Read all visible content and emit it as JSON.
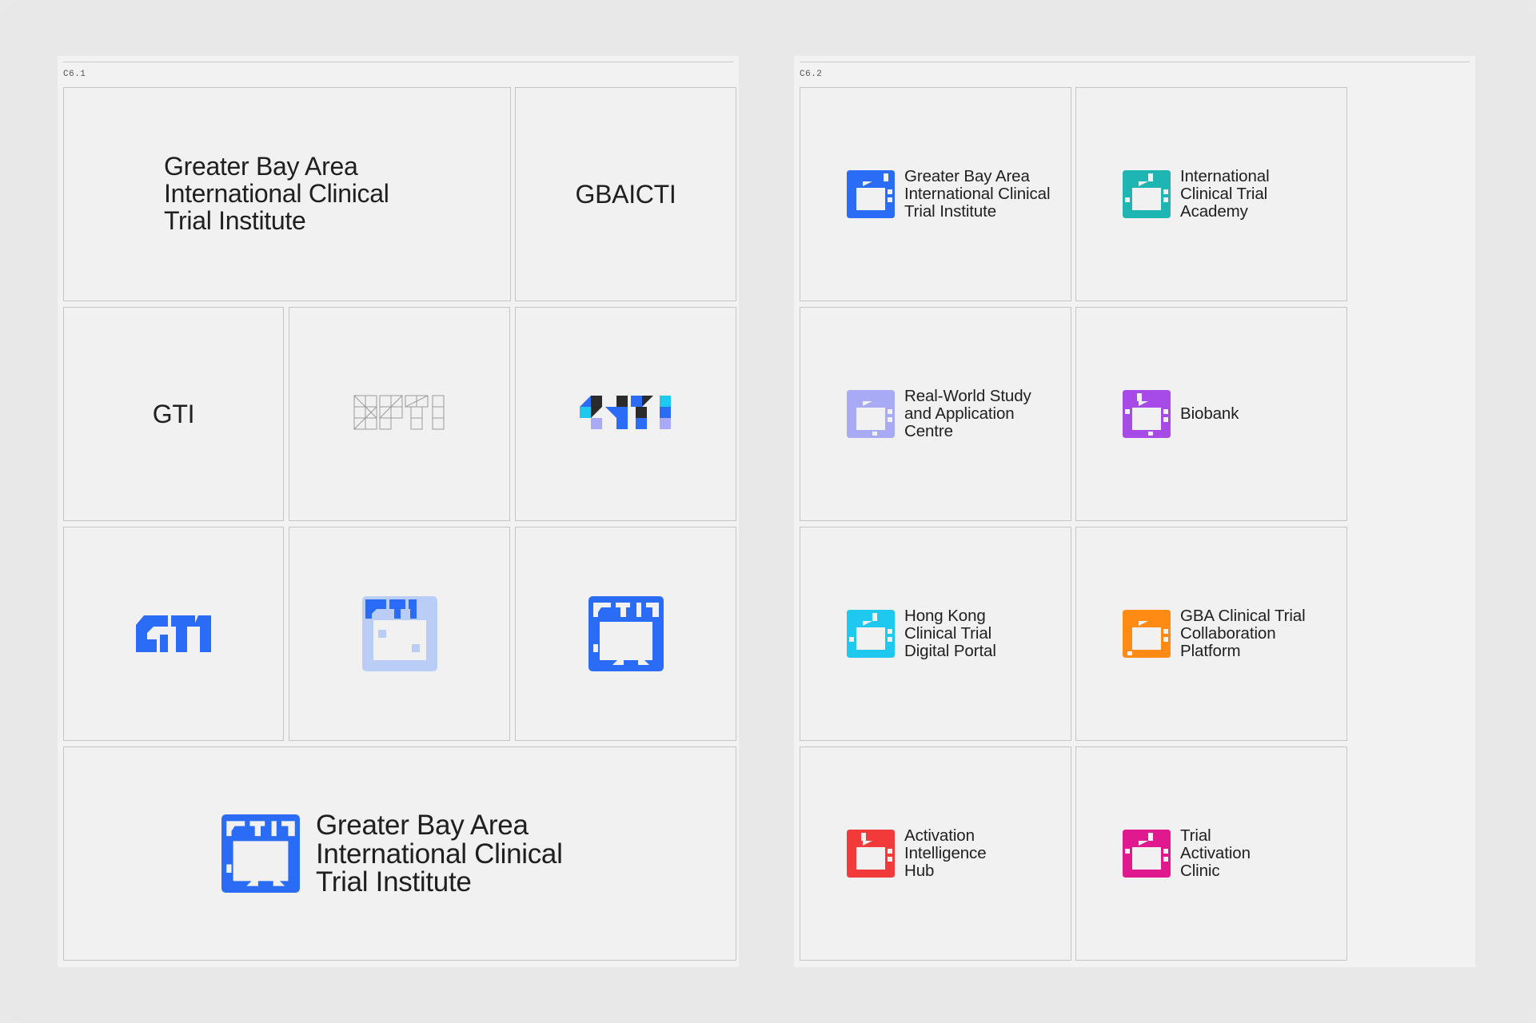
{
  "sheets": {
    "left": {
      "code": "C6.1"
    },
    "right": {
      "code": "C6.2"
    }
  },
  "left": {
    "full_name": [
      "Greater Bay Area",
      "International Clinical",
      "Trial Institute"
    ],
    "acronym": "GBAICTI",
    "short": "GTI",
    "lockup_name": [
      "Greater Bay Area",
      "International Clinical",
      "Trial Institute"
    ]
  },
  "colors": {
    "primary_blue": "#2a6cf5",
    "light_blue": "#b9cdf6",
    "teal": "#1fb5b3",
    "lavender": "#a8aaf5",
    "purple": "#a64be8",
    "cyan": "#1ec8ee",
    "orange": "#ff8a14",
    "red": "#f33a3a",
    "magenta": "#e0198f",
    "dark": "#2b2b2b"
  },
  "sub_brands": [
    {
      "lines": [
        "Greater Bay Area",
        "International Clinical",
        "Trial Institute"
      ],
      "color": "#2a6cf5",
      "icon": "gbaicti-mark-icon"
    },
    {
      "lines": [
        "International",
        "Clinical Trial",
        "Academy"
      ],
      "color": "#1fb5b3",
      "icon": "academy-mark-icon"
    },
    {
      "lines": [
        "Real-World Study",
        "and Application",
        "Centre"
      ],
      "color": "#a8aaf5",
      "icon": "rws-mark-icon"
    },
    {
      "lines": [
        "Biobank"
      ],
      "color": "#a64be8",
      "icon": "biobank-mark-icon"
    },
    {
      "lines": [
        "Hong Kong",
        "Clinical Trial",
        "Digital Portal"
      ],
      "color": "#1ec8ee",
      "icon": "hk-portal-mark-icon"
    },
    {
      "lines": [
        "GBA Clinical Trial",
        "Collaboration",
        "Platform"
      ],
      "color": "#ff8a14",
      "icon": "collab-platform-mark-icon"
    },
    {
      "lines": [
        "Activation",
        "Intelligence",
        "Hub"
      ],
      "color": "#f33a3a",
      "icon": "activation-hub-mark-icon"
    },
    {
      "lines": [
        "Trial",
        "Activation",
        "Clinic"
      ],
      "color": "#e0198f",
      "icon": "trial-clinic-mark-icon"
    }
  ]
}
